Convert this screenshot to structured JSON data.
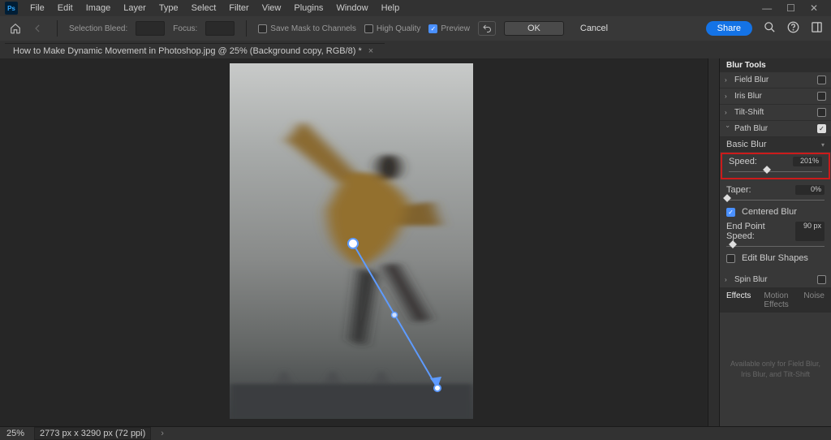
{
  "logo": "Ps",
  "menu": [
    "File",
    "Edit",
    "Image",
    "Layer",
    "Type",
    "Select",
    "Filter",
    "View",
    "Plugins",
    "Window",
    "Help"
  ],
  "optbar": {
    "selbleed": "Selection Bleed:",
    "focus": "Focus:",
    "savemask": "Save Mask to Channels",
    "hq": "High Quality",
    "preview": "Preview",
    "ok": "OK",
    "cancel": "Cancel",
    "share": "Share"
  },
  "doc": {
    "tab": "How to Make Dynamic Movement in Photoshop.jpg @ 25% (Background copy, RGB/8) *",
    "close": "×"
  },
  "panel": {
    "title": "Blur Tools",
    "field": "Field Blur",
    "iris": "Iris Blur",
    "tilt": "Tilt-Shift",
    "path": "Path Blur",
    "spin": "Spin Blur",
    "basic": "Basic Blur",
    "speed": {
      "label": "Speed:",
      "value": "201%"
    },
    "taper": {
      "label": "Taper:",
      "value": "0%"
    },
    "centered": "Centered Blur",
    "endpoint": {
      "label": "End Point Speed:",
      "value": "90 px"
    },
    "editshapes": "Edit Blur Shapes"
  },
  "tabs2": {
    "effects": "Effects",
    "motion": "Motion Effects",
    "noise": "Noise"
  },
  "effects_placeholder": "Available only for Field Blur, Iris Blur, and Tilt-Shift",
  "status": {
    "zoom": "25%",
    "doc": "2773 px x 3290 px (72 ppi)"
  }
}
